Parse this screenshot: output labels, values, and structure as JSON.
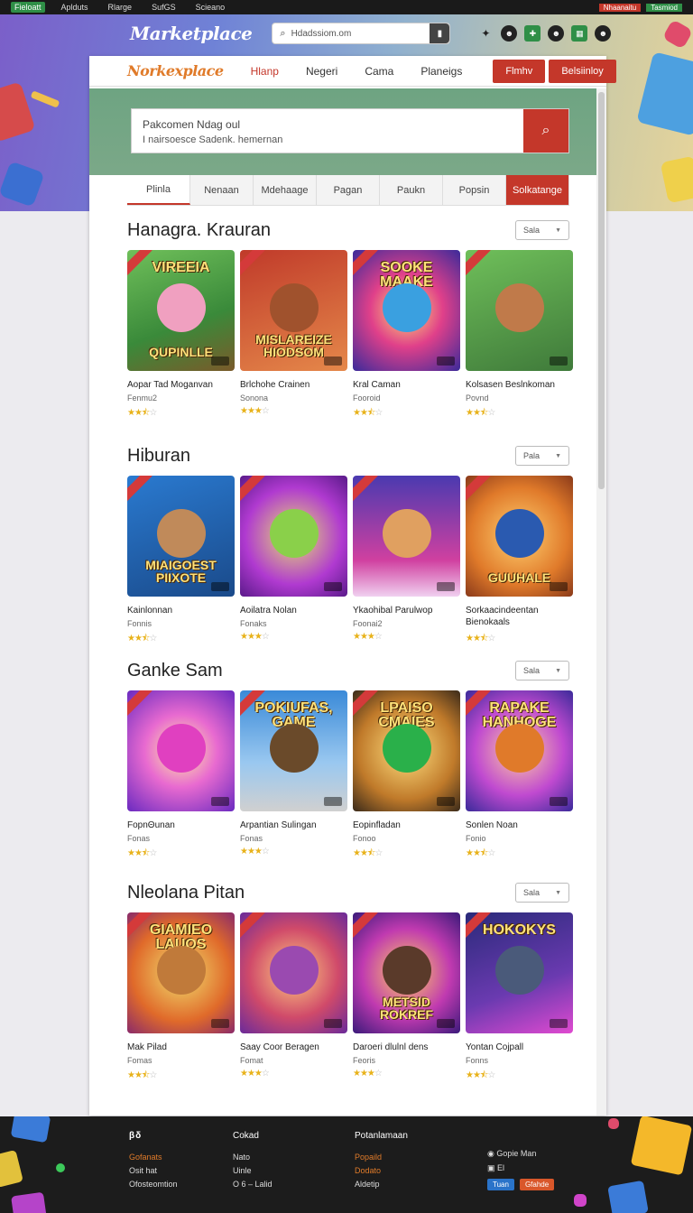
{
  "topstrip": {
    "items": [
      "Fieloatt",
      "Aplduts",
      "Rlarge",
      "SufGS",
      "Scieano"
    ],
    "right": [
      "Nhaanaitu",
      "Tasmiod"
    ]
  },
  "brand": {
    "logo": "Marketplace",
    "search_placeholder": "Hdadssiom.om"
  },
  "nav": {
    "logo": "Norkexplace",
    "links": [
      "Hlanp",
      "Negeri",
      "Cama",
      "Planeigs"
    ],
    "buttons": [
      "Flmhv",
      "Belsiinloy"
    ]
  },
  "search": {
    "line1": "Pakcomen Ndag oul",
    "line2": "I nairsoesce Sadenk. hemernan"
  },
  "tabs": [
    "Plinla",
    "Nenaan",
    "Mdehaage",
    "Pagan",
    "Paukn",
    "Popsin",
    "Solkatange"
  ],
  "sections": [
    {
      "title": "Hanagra. Krauran",
      "select": "Sala",
      "cards": [
        {
          "top": "VIREEIA",
          "bottom": "QUPINLLE",
          "name": "Aopar Tad Moganvan",
          "sub": "Fenmu2",
          "rating": 2.5
        },
        {
          "top": "",
          "bottom": "MISLAREIZE HIODSOM",
          "name": "Brlchohe Crainen",
          "sub": "Sonona",
          "rating": 3
        },
        {
          "top": "SOOKE MAAKE",
          "bottom": "",
          "name": "Kral Caman",
          "sub": "Fooroid",
          "rating": 2.5
        },
        {
          "top": "",
          "bottom": "",
          "name": "Kolsasen Beslnkoman",
          "sub": "Povnd",
          "rating": 2.5
        }
      ]
    },
    {
      "title": "Hiburan",
      "select": "Pala",
      "cards": [
        {
          "top": "",
          "bottom": "MIAIGOEST PIIXOTE",
          "name": "Kainlonnan",
          "sub": "Fonnis",
          "rating": 2.5
        },
        {
          "top": "",
          "bottom": "",
          "name": "Aoilatra Nolan",
          "sub": "Fonaks",
          "rating": 3
        },
        {
          "top": "",
          "bottom": "",
          "name": "Ykaohibal Parulwop",
          "sub": "Foonai2",
          "rating": 3
        },
        {
          "top": "",
          "bottom": "GUUHALE",
          "name": "Sorkaacindeentan Bienokaals",
          "sub": "",
          "rating": 2.5
        }
      ]
    },
    {
      "title": "Ganke Sam",
      "select": "Sala",
      "cards": [
        {
          "top": "",
          "bottom": "",
          "name": "FopnΘunan",
          "sub": "Fonas",
          "rating": 2.5
        },
        {
          "top": "POKIUFAS, GAME",
          "bottom": "",
          "name": "Arpantian Sulingan",
          "sub": "Fonas",
          "rating": 3
        },
        {
          "top": "LPAISO CMAIES",
          "bottom": "",
          "name": "Eopinfladan",
          "sub": "Fonoo",
          "rating": 2.5
        },
        {
          "top": "RAPAKE HANHOGE",
          "bottom": "",
          "name": "Sonlen Noan",
          "sub": "Fonio",
          "rating": 2.5
        }
      ]
    },
    {
      "title": "Nleolana Pitan",
      "select": "Sala",
      "cards": [
        {
          "top": "GIAMIEO LAUOS",
          "bottom": "",
          "name": "Mak Pilad",
          "sub": "Fomas",
          "rating": 2.5
        },
        {
          "top": "",
          "bottom": "",
          "name": "Saay Coor Beragen",
          "sub": "Fomat",
          "rating": 3
        },
        {
          "top": "",
          "bottom": "METSID ROKREF",
          "name": "Daroeri dlulnl dens",
          "sub": "Feoris",
          "rating": 3
        },
        {
          "top": "HOKOKYS",
          "bottom": "",
          "name": "Yontan Cojpall",
          "sub": "Fonns",
          "rating": 2.5
        }
      ]
    }
  ],
  "footer": {
    "logo": "βδ",
    "col1": [
      "Gofanats",
      "Osit hat",
      "Ofosteomtion"
    ],
    "col2_title": "Cokad",
    "col2": [
      "Nato",
      "Uinle",
      "O 6 – Lalid"
    ],
    "col3_title": "Potanlamaan",
    "col3": [
      "Popaild",
      "Dodato",
      "Aldetip"
    ],
    "col4": [
      "Gopie Man",
      "El"
    ],
    "social": [
      "Tuan",
      "Gfahde"
    ]
  },
  "colors": {
    "accent": "#c4372a",
    "brand_orange": "#e07b2a",
    "star": "#e8b21a"
  }
}
